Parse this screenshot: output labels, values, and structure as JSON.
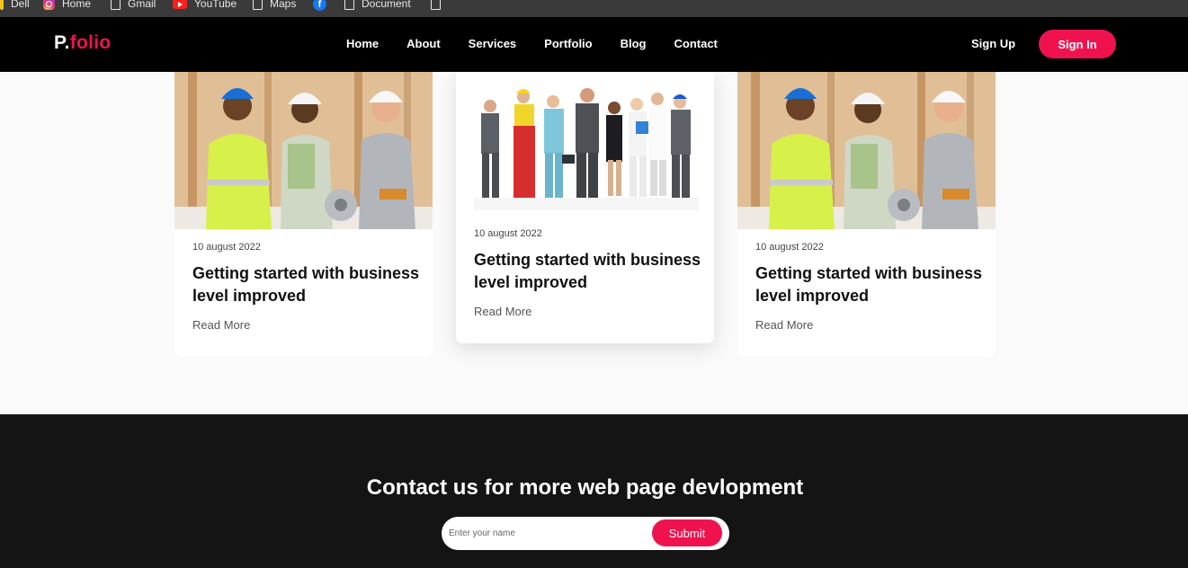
{
  "bookmarks": [
    {
      "label": "Dell",
      "icon": "dell-icon"
    },
    {
      "label": "Home",
      "icon": "instagram-icon"
    },
    {
      "label": "Gmail",
      "icon": "page-icon"
    },
    {
      "label": "YouTube",
      "icon": "youtube-icon"
    },
    {
      "label": "Maps",
      "icon": "page-icon"
    },
    {
      "label": "",
      "icon": "facebook-icon"
    },
    {
      "label": "Document",
      "icon": "page-icon"
    },
    {
      "label": "",
      "icon": "page-icon"
    }
  ],
  "nav": {
    "logo_main": "P.",
    "logo_accent": "folio",
    "links": [
      "Home",
      "About",
      "Services",
      "Portfolio",
      "Blog",
      "Contact"
    ],
    "signup_label": "Sign Up",
    "signin_label": "Sign In"
  },
  "cards": [
    {
      "image": "construction-workers-photo",
      "date": "10 august 2022",
      "title": "Getting started with business level improved",
      "more": "Read More"
    },
    {
      "image": "professionals-group-photo",
      "date": "10 august 2022",
      "title": "Getting started with business level improved",
      "more": "Read More"
    },
    {
      "image": "construction-workers-photo",
      "date": "10 august 2022",
      "title": "Getting started with business level improved",
      "more": "Read More"
    }
  ],
  "contact": {
    "heading": "Contact us for more web page devlopment",
    "input_placeholder": "Enter your name",
    "submit_label": "Submit"
  },
  "colors": {
    "accent": "#f0124f",
    "nav_bg": "#000000",
    "footer_bg": "#141414",
    "page_bg": "#fafafa"
  }
}
